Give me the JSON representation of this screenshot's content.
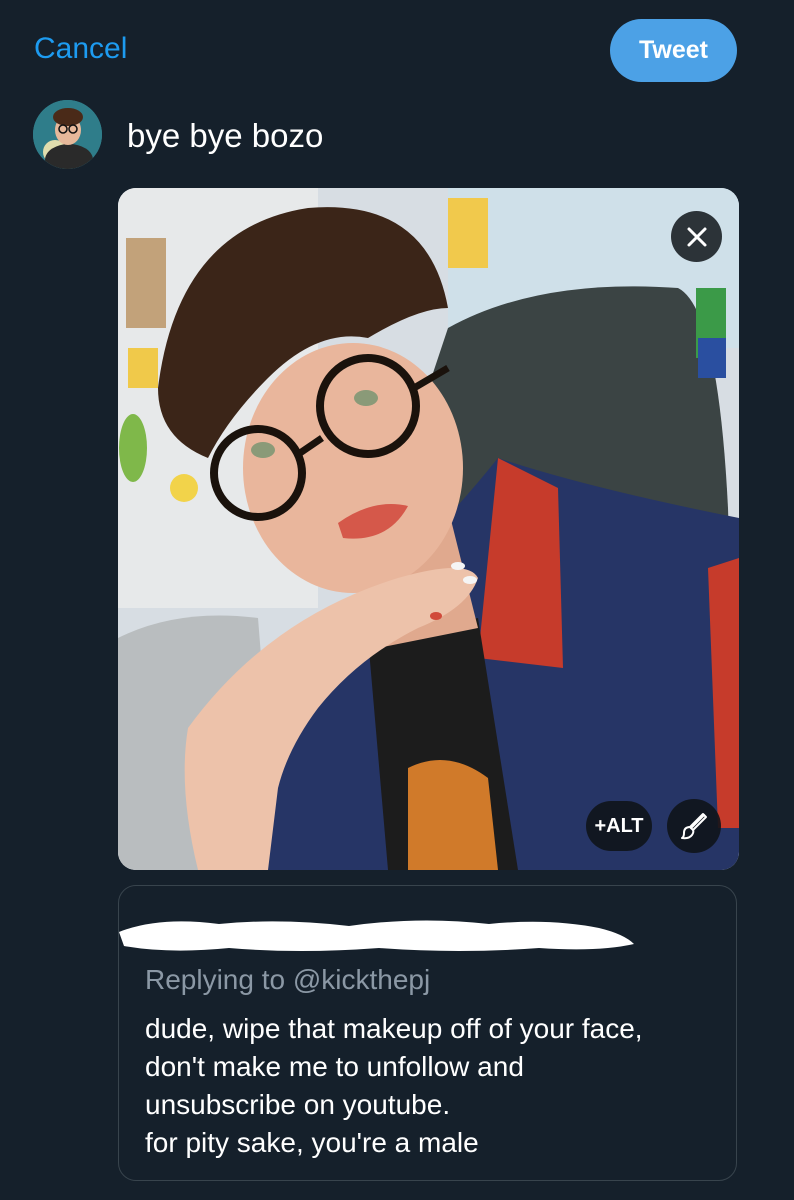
{
  "header": {
    "cancel_label": "Cancel",
    "tweet_label": "Tweet"
  },
  "compose": {
    "text": "bye bye bozo"
  },
  "media": {
    "alt_label": "+ALT"
  },
  "quoted_tweet": {
    "replying_to": "Replying to @kickthepj",
    "lines": [
      "dude, wipe that makeup off of your face,",
      "don't make me to unfollow and",
      "unsubscribe on youtube.",
      "for pity sake, you're a male"
    ]
  },
  "colors": {
    "background": "#15202b",
    "accent": "#1d9bf0",
    "tweet_button": "#4ca1e6",
    "muted_text": "#8b98a5",
    "border": "#38444d"
  },
  "icons": {
    "remove_media": "close-icon",
    "edit_media": "brush-icon"
  }
}
